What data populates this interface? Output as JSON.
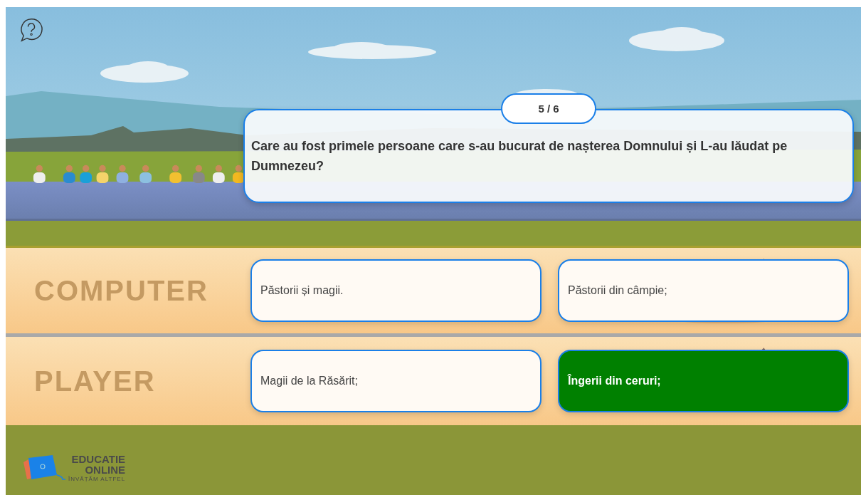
{
  "progress": "5 / 6",
  "question": "Care au fost primele persoane care s-au bucurat de nașterea Domnului și L-au lăudat pe Dumnezeu?",
  "lanes": [
    {
      "label": "COMPUTER",
      "answers": [
        {
          "text": "Păstorii și magii.",
          "selected": false
        },
        {
          "text": "Păstorii din câmpie;",
          "selected": false
        }
      ]
    },
    {
      "label": "PLAYER",
      "answers": [
        {
          "text": "Magii de la Răsărit;",
          "selected": false
        },
        {
          "text": "Îngerii din ceruri;",
          "selected": true
        }
      ]
    }
  ],
  "logo": {
    "line_1": "EDUCATIE",
    "line_2": "ONLINE",
    "tagline": "ÎNVĂȚĂM ALTFEL"
  }
}
